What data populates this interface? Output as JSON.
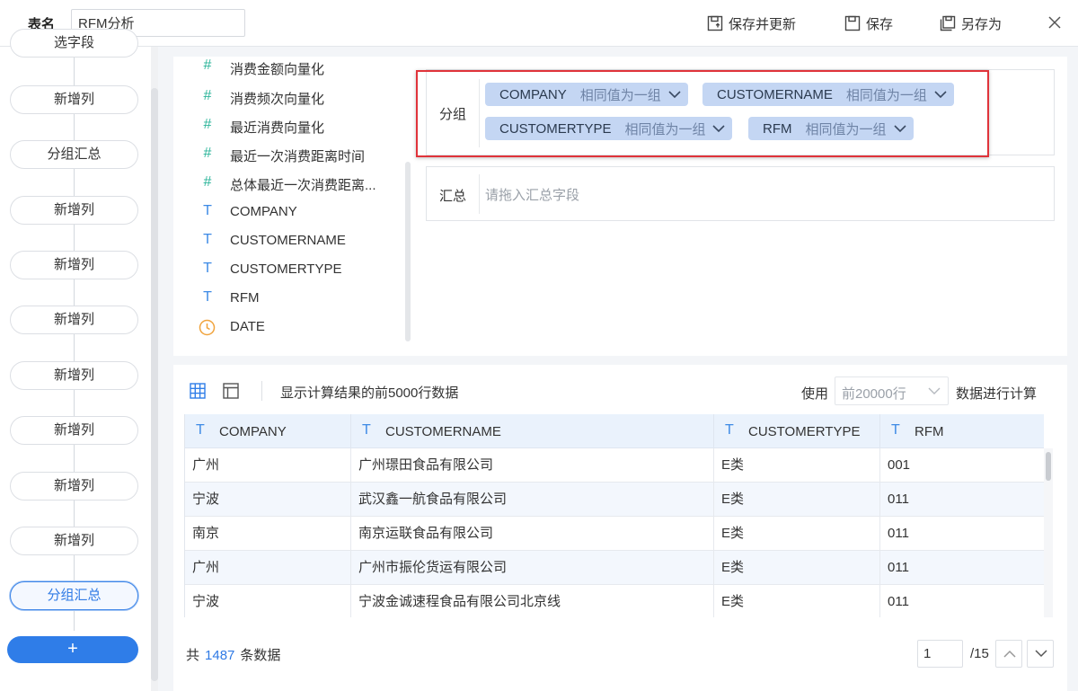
{
  "topbar": {
    "table_name_label": "表名",
    "table_name_value": "RFM分析",
    "save_update": "保存并更新",
    "save": "保存",
    "save_as": "另存为"
  },
  "steps": {
    "partial_top": "选字段",
    "items": [
      "新增列",
      "分组汇总",
      "新增列",
      "新增列",
      "新增列",
      "新增列",
      "新增列",
      "新增列",
      "新增列",
      "分组汇总"
    ],
    "add": "+"
  },
  "fields": [
    {
      "type": "number",
      "icon": "#",
      "name": "消费金额向量化"
    },
    {
      "type": "number",
      "icon": "#",
      "name": "消费频次向量化"
    },
    {
      "type": "number",
      "icon": "#",
      "name": "最近消费向量化"
    },
    {
      "type": "number",
      "icon": "#",
      "name": "最近一次消费距离时间"
    },
    {
      "type": "number",
      "icon": "#",
      "name": "总体最近一次消费距离..."
    },
    {
      "type": "text",
      "icon": "T",
      "name": "COMPANY"
    },
    {
      "type": "text",
      "icon": "T",
      "name": "CUSTOMERNAME"
    },
    {
      "type": "text",
      "icon": "T",
      "name": "CUSTOMERTYPE"
    },
    {
      "type": "text",
      "icon": "T",
      "name": "RFM"
    },
    {
      "type": "date",
      "icon": "clock-icon",
      "name": "DATE"
    }
  ],
  "group_zone": {
    "label": "分组",
    "chips": [
      {
        "name": "COMPANY",
        "mode": "相同值为一组"
      },
      {
        "name": "CUSTOMERNAME",
        "mode": "相同值为一组"
      },
      {
        "name": "CUSTOMERTYPE",
        "mode": "相同值为一组"
      },
      {
        "name": "RFM",
        "mode": "相同值为一组"
      }
    ]
  },
  "summary_zone": {
    "label": "汇总",
    "placeholder": "请拖入汇总字段"
  },
  "preview": {
    "info": "显示计算结果的前5000行数据",
    "use_label": "使用",
    "rows_select": "前20000行",
    "calc_label": "数据进行计算",
    "columns": [
      {
        "icon": "T",
        "name": "COMPANY"
      },
      {
        "icon": "T",
        "name": "CUSTOMERNAME"
      },
      {
        "icon": "T",
        "name": "CUSTOMERTYPE"
      },
      {
        "icon": "T",
        "name": "RFM"
      }
    ],
    "rows": [
      [
        "广州",
        "广州璟田食品有限公司",
        "E类",
        "001"
      ],
      [
        "宁波",
        "武汉鑫一航食品有限公司",
        "E类",
        "011"
      ],
      [
        "南京",
        "南京运联食品有限公司",
        "E类",
        "011"
      ],
      [
        "广州",
        "广州市振伦货运有限公司",
        "E类",
        "011"
      ],
      [
        "宁波",
        "宁波金诚速程食品有限公司北京线",
        "E类",
        "011"
      ]
    ]
  },
  "footer": {
    "total_prefix": "共",
    "total_count": "1487",
    "total_suffix": "条数据",
    "page_current": "1",
    "page_total": "/15"
  },
  "colors": {
    "accent": "#2f7de8",
    "chip_bg": "#c4d6f3",
    "highlight_border": "#e0333a",
    "number_icon": "#2db59a",
    "text_icon": "#3d8ae5",
    "date_icon": "#f0a33c"
  }
}
